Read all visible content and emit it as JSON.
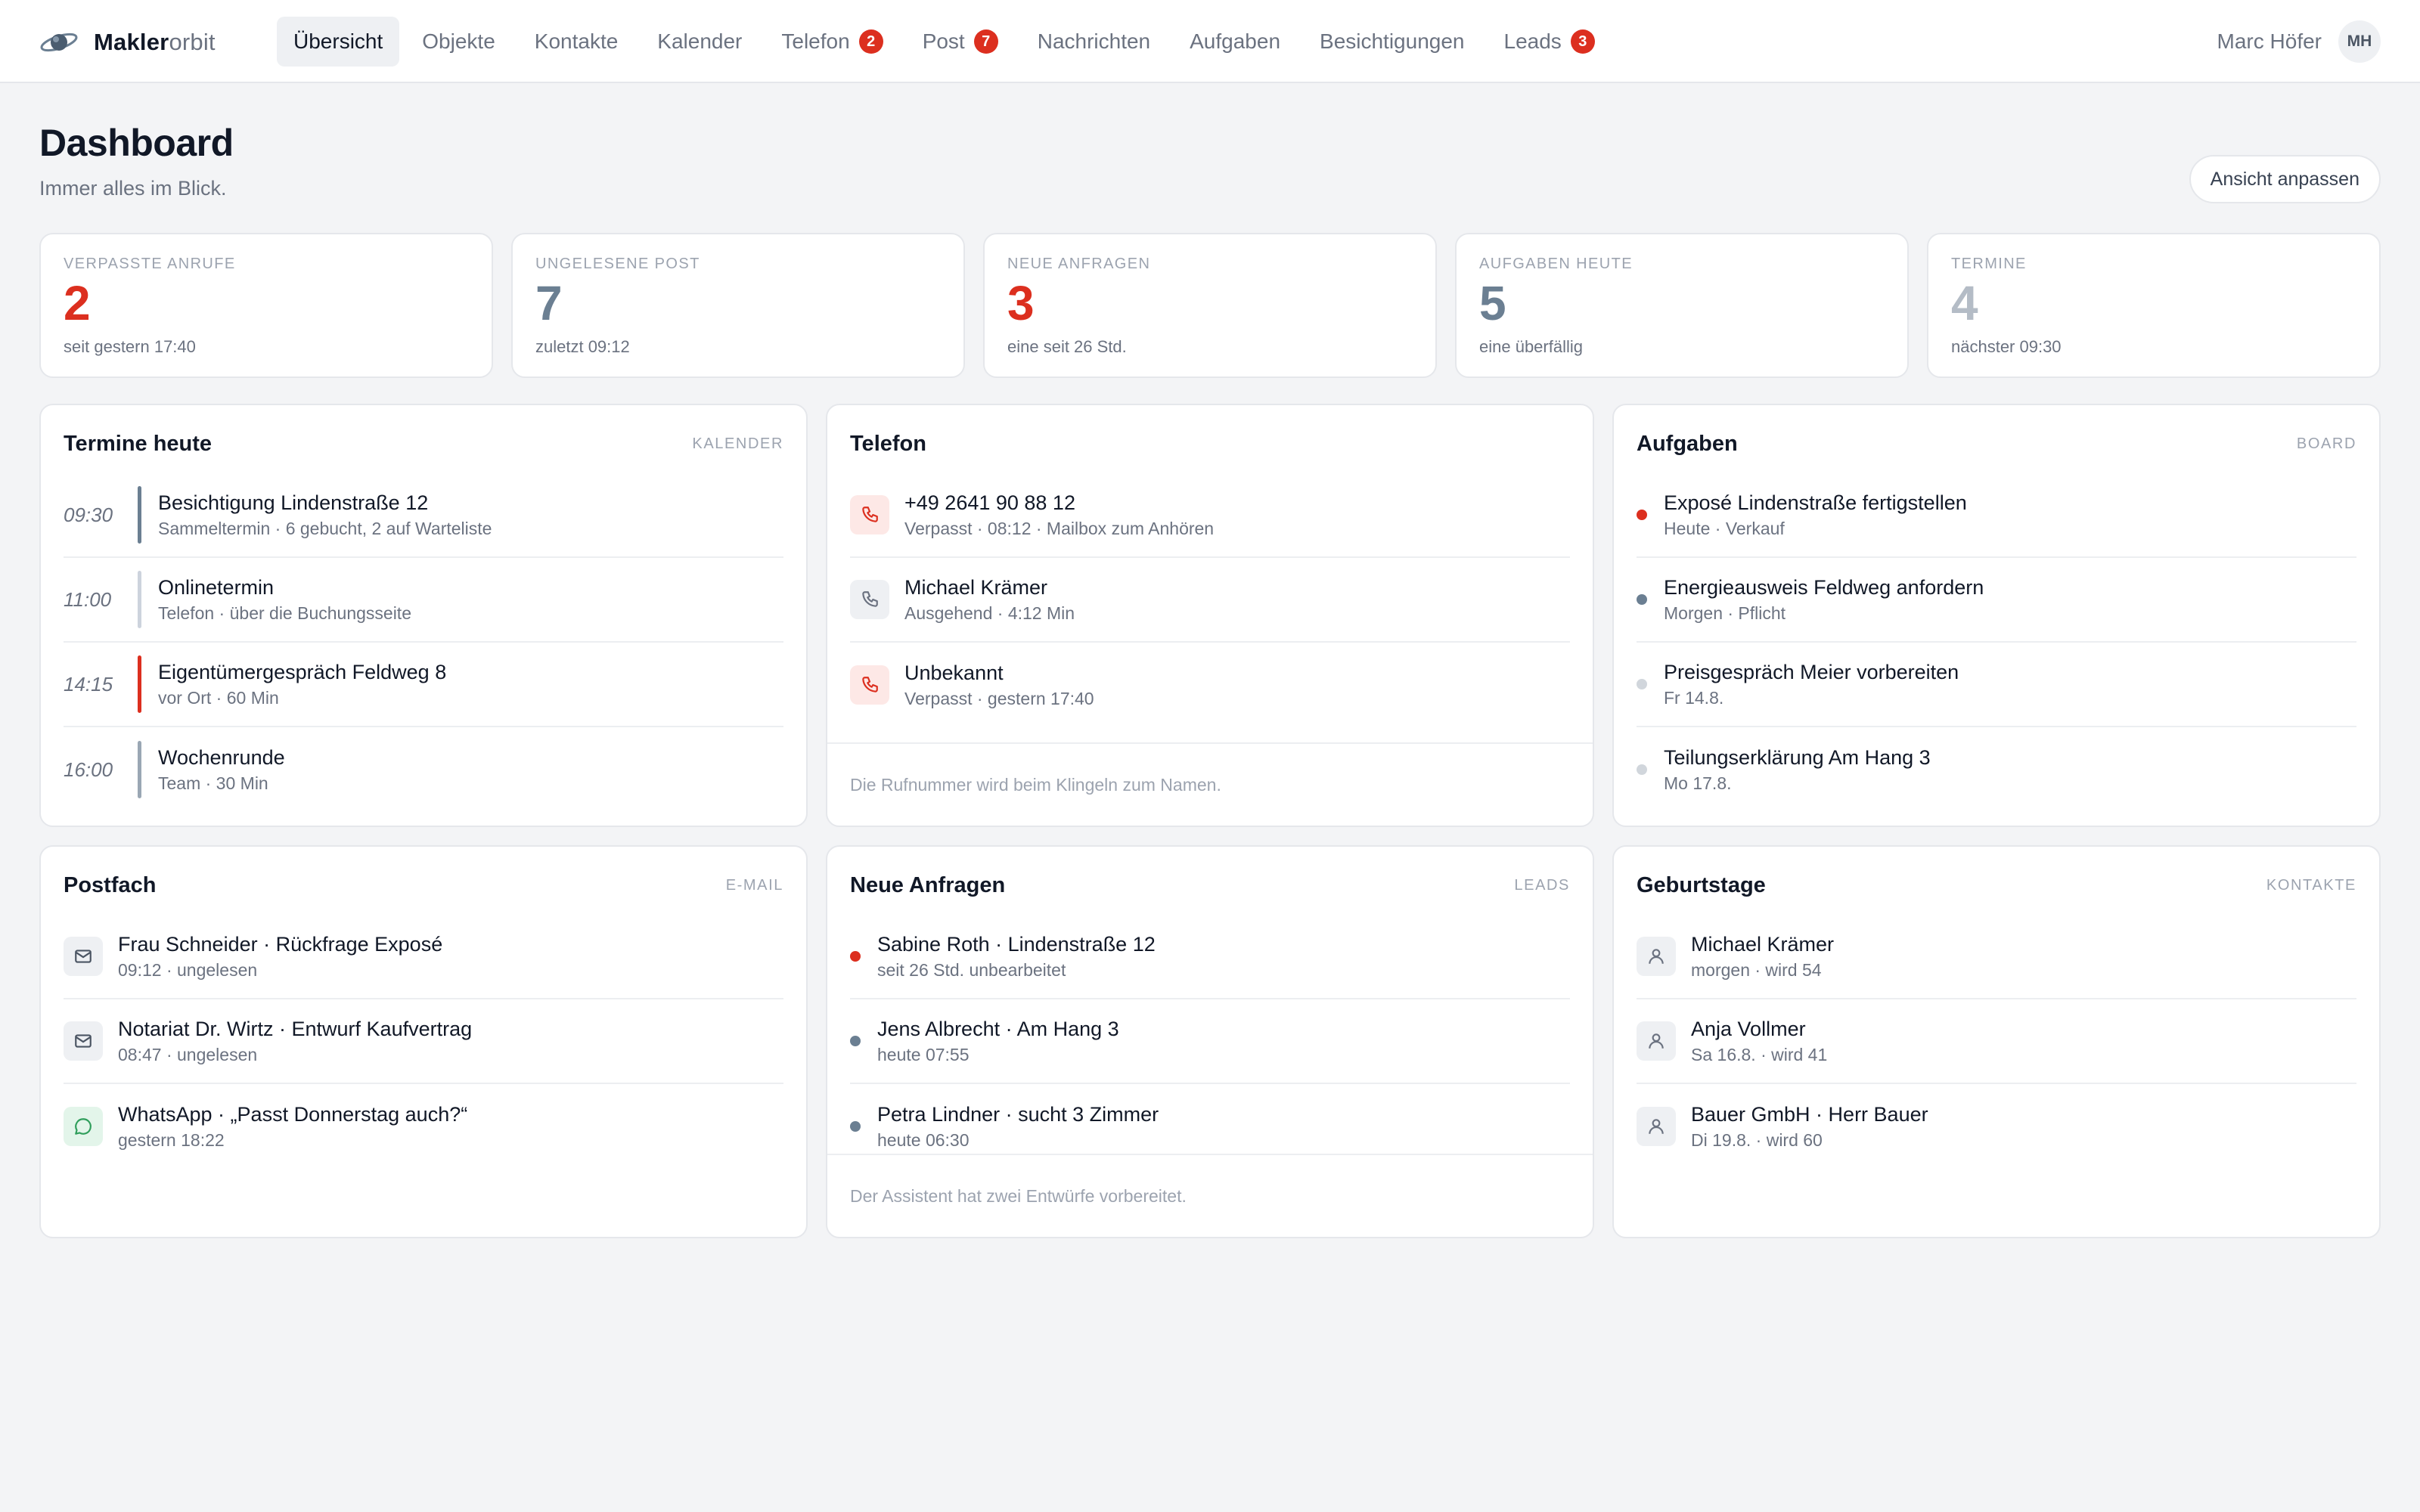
{
  "app": {
    "brand_bold": "Makler",
    "brand_light": "orbit"
  },
  "nav": [
    {
      "label": "Übersicht",
      "active": true
    },
    {
      "label": "Objekte"
    },
    {
      "label": "Kontakte"
    },
    {
      "label": "Kalender"
    },
    {
      "label": "Telefon",
      "badge": "2"
    },
    {
      "label": "Post",
      "badge": "7"
    },
    {
      "label": "Nachrichten"
    },
    {
      "label": "Aufgaben"
    },
    {
      "label": "Besichtigungen"
    },
    {
      "label": "Leads",
      "badge": "3"
    }
  ],
  "user": {
    "name": "Marc Höfer",
    "initials": "MH"
  },
  "header": {
    "title": "Dashboard",
    "subtitle": "Immer alles im Blick.",
    "customize_label": "Ansicht anpassen"
  },
  "stats": [
    {
      "label": "VERPASSTE ANRUFE",
      "value": "2",
      "sub": "seit gestern 17:40",
      "color": "#dc2f1f"
    },
    {
      "label": "UNGELESENE POST",
      "value": "7",
      "sub": "zuletzt 09:12",
      "color": "#6b7f92"
    },
    {
      "label": "NEUE ANFRAGEN",
      "value": "3",
      "sub": "eine seit 26 Std.",
      "color": "#dc2f1f"
    },
    {
      "label": "AUFGABEN HEUTE",
      "value": "5",
      "sub": "eine überfällig",
      "color": "#6b7f92"
    },
    {
      "label": "TERMINE",
      "value": "4",
      "sub": "nächster 09:30",
      "color": "#b4bcc6"
    }
  ],
  "appointments": {
    "title": "Termine heute",
    "link": "KALENDER",
    "items": [
      {
        "time": "09:30",
        "title": "Besichtigung Lindenstraße 12",
        "sub": "Sammeltermin · 6 gebucht, 2 auf Warteliste",
        "color": "#6b7f92"
      },
      {
        "time": "11:00",
        "title": "Onlinetermin",
        "sub": "Telefon · über die Buchungsseite",
        "color": "#cdd3dd"
      },
      {
        "time": "14:15",
        "title": "Eigentümergespräch Feldweg 8",
        "sub": "vor Ort · 60 Min",
        "color": "#dc2f1f"
      },
      {
        "time": "16:00",
        "title": "Wochenrunde",
        "sub": "Team · 30 Min",
        "color": "#9aa7b4"
      }
    ]
  },
  "phone": {
    "title": "Telefon",
    "items": [
      {
        "title": "+49 2641 90 88 12",
        "sub": "Verpasst · 08:12 · Mailbox zum Anhören",
        "icon": "phone-missed-icon",
        "missed": true
      },
      {
        "title": "Michael Krämer",
        "sub": "Ausgehend · 4:12 Min",
        "icon": "phone-icon",
        "missed": false
      },
      {
        "title": "Unbekannt",
        "sub": "Verpasst · gestern 17:40",
        "icon": "phone-missed-icon",
        "missed": true
      }
    ],
    "footer": "Die Rufnummer wird beim Klingeln zum Namen."
  },
  "tasks": {
    "title": "Aufgaben",
    "link": "BOARD",
    "items": [
      {
        "title": "Exposé Lindenstraße fertigstellen",
        "sub": "Heute · Verkauf",
        "color": "#dc2f1f"
      },
      {
        "title": "Energieausweis Feldweg anfordern",
        "sub": "Morgen · Pflicht",
        "color": "#6b7f92"
      },
      {
        "title": "Preisgespräch Meier vorbereiten",
        "sub": "Fr 14.8.",
        "color": "#d1d6dc"
      },
      {
        "title": "Teilungserklärung Am Hang 3",
        "sub": "Mo 17.8.",
        "color": "#d1d6dc"
      }
    ]
  },
  "mail": {
    "title": "Postfach",
    "link": "E-MAIL",
    "items": [
      {
        "title": "Frau Schneider · Rückfrage Exposé",
        "sub": "09:12 · ungelesen",
        "icon": "mail-icon"
      },
      {
        "title": "Notariat Dr. Wirtz · Entwurf Kaufvertrag",
        "sub": "08:47 · ungelesen",
        "icon": "mail-icon"
      },
      {
        "title": "WhatsApp · „Passt Donnerstag auch?“",
        "sub": "gestern 18:22",
        "icon": "chat-icon"
      }
    ]
  },
  "leads": {
    "title": "Neue Anfragen",
    "link": "LEADS",
    "items": [
      {
        "title": "Sabine Roth · Lindenstraße 12",
        "sub": "seit 26 Std. unbearbeitet",
        "color": "#dc2f1f"
      },
      {
        "title": "Jens Albrecht · Am Hang 3",
        "sub": "heute 07:55",
        "color": "#6b7f92"
      },
      {
        "title": "Petra Lindner · sucht 3 Zimmer",
        "sub": "heute 06:30",
        "color": "#6b7f92"
      }
    ],
    "footer": "Der Assistent hat zwei Entwürfe vorbereitet."
  },
  "birthdays": {
    "title": "Geburtstage",
    "link": "KONTAKTE",
    "items": [
      {
        "title": "Michael Krämer",
        "sub": "morgen · wird 54",
        "icon": "person-icon"
      },
      {
        "title": "Anja Vollmer",
        "sub": "Sa 16.8. · wird 41",
        "icon": "person-icon"
      },
      {
        "title": "Bauer GmbH · Herr Bauer",
        "sub": "Di 19.8. · wird 60",
        "icon": "person-icon"
      }
    ]
  }
}
